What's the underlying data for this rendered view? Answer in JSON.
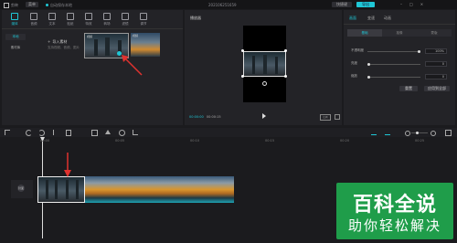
{
  "titlebar": {
    "app_name": "剪映",
    "menu_label": "菜单",
    "status_text": "自动保存本地",
    "project_title": "202106251659",
    "shortcut_label": "快捷键",
    "export_label": "导出"
  },
  "toolbar": {
    "items": [
      {
        "label": "媒体",
        "icon": "media-icon"
      },
      {
        "label": "音频",
        "icon": "audio-icon"
      },
      {
        "label": "文本",
        "icon": "text-icon"
      },
      {
        "label": "贴纸",
        "icon": "sticker-icon"
      },
      {
        "label": "特效",
        "icon": "effects-icon"
      },
      {
        "label": "转场",
        "icon": "transition-icon"
      },
      {
        "label": "滤镜",
        "icon": "filter-icon"
      },
      {
        "label": "调节",
        "icon": "adjust-icon"
      }
    ]
  },
  "media": {
    "local_label": "本地",
    "library_label": "素材库",
    "import_label": "导入素材",
    "import_hint": "支持视频、音频、图片",
    "clip1_label": "视频",
    "clip2_label": "视频"
  },
  "player": {
    "title": "播放器",
    "time_current": "00:00:00",
    "time_total": "00:00:15",
    "ratio_label": "比例"
  },
  "inspector": {
    "tabs": [
      "画面",
      "变速",
      "动画"
    ],
    "subtabs": [
      "基础",
      "抠像",
      "蒙版"
    ],
    "rows": [
      {
        "label": "不透明度",
        "value": "100%",
        "fill": 0.95
      },
      {
        "label": "亮度",
        "value": "0",
        "fill": 0.0
      },
      {
        "label": "缩放",
        "value": "0",
        "fill": 0.0
      }
    ],
    "reset_label": "重置",
    "apply_all_label": "应用到全部"
  },
  "timeline": {
    "ticks": [
      "00:00",
      "00:05",
      "00:10",
      "00:15",
      "00:20",
      "00:25"
    ],
    "cover_label": "封面"
  },
  "watermark": {
    "title": "百科全说",
    "subtitle": "助你轻松解决"
  },
  "colors": {
    "accent": "#1fc7d6",
    "arrow": "#e0322f",
    "watermark_bg": "#1f9d4a"
  }
}
